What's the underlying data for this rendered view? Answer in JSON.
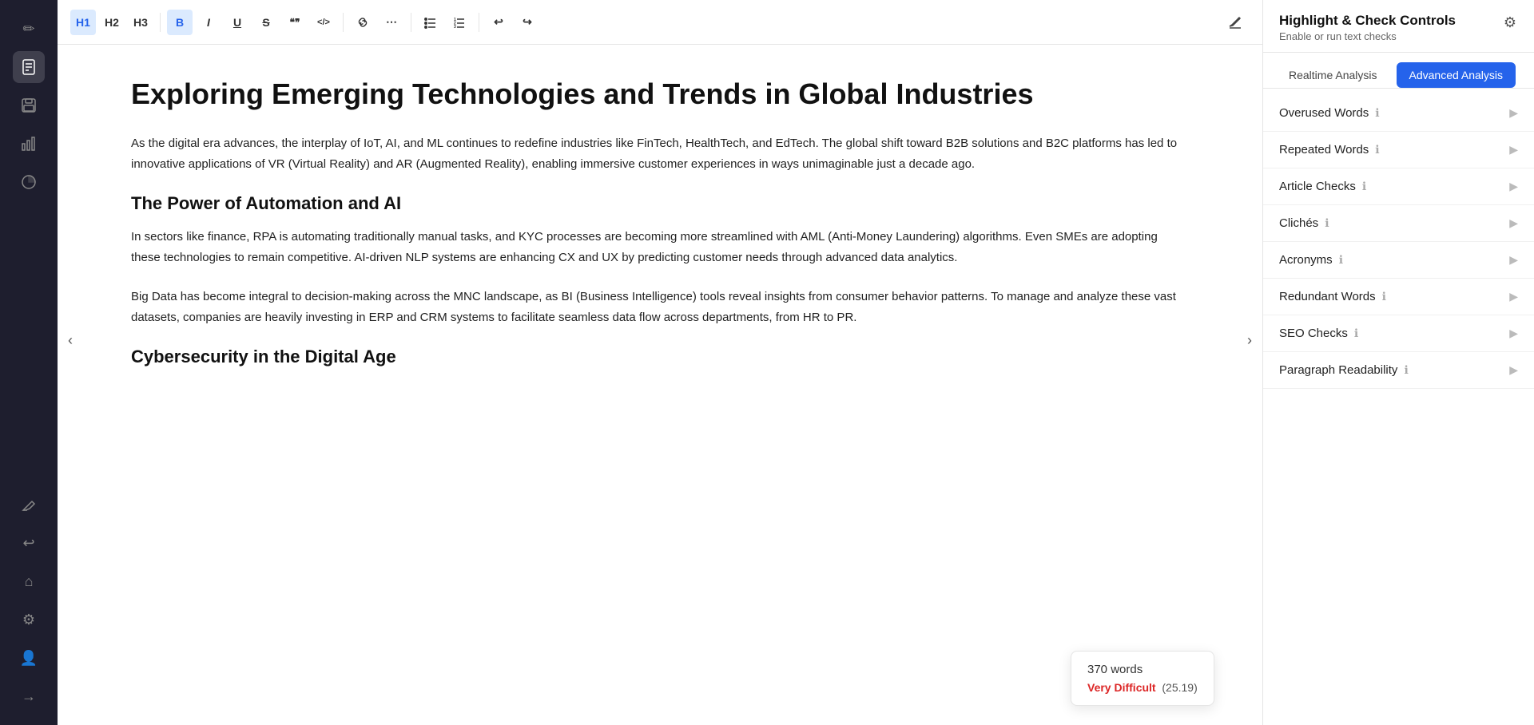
{
  "sidebar": {
    "icons": [
      {
        "name": "pen-icon",
        "symbol": "✏",
        "active": false
      },
      {
        "name": "document-icon",
        "symbol": "📄",
        "active": true
      },
      {
        "name": "save-icon",
        "symbol": "💾",
        "active": false
      },
      {
        "name": "chart-bar-icon",
        "symbol": "📊",
        "active": false
      },
      {
        "name": "chart-pie-icon",
        "symbol": "◑",
        "active": false
      },
      {
        "name": "highlight-icon",
        "symbol": "✏️",
        "active": false
      },
      {
        "name": "undo-icon",
        "symbol": "↩",
        "active": false
      },
      {
        "name": "home-icon",
        "symbol": "⌂",
        "active": false
      }
    ],
    "bottom_icons": [
      {
        "name": "settings-icon",
        "symbol": "⚙"
      },
      {
        "name": "user-icon",
        "symbol": "👤"
      },
      {
        "name": "arrow-right-icon",
        "symbol": "→"
      }
    ]
  },
  "toolbar": {
    "buttons": [
      {
        "name": "h1-button",
        "label": "H1",
        "active": true
      },
      {
        "name": "h2-button",
        "label": "H2",
        "active": false
      },
      {
        "name": "h3-button",
        "label": "H3",
        "active": false
      },
      {
        "name": "bold-button",
        "label": "B",
        "active": true
      },
      {
        "name": "italic-button",
        "label": "I",
        "active": false
      },
      {
        "name": "underline-button",
        "label": "U",
        "active": false
      },
      {
        "name": "strikethrough-button",
        "label": "S",
        "active": false
      },
      {
        "name": "quote-button",
        "label": "❝❞",
        "active": false
      },
      {
        "name": "code-button",
        "label": "</>",
        "active": false
      },
      {
        "name": "link-button",
        "label": "🔗",
        "active": false
      },
      {
        "name": "more-button",
        "label": "⋯",
        "active": false
      },
      {
        "name": "bullet-list-button",
        "label": "☰",
        "active": false
      },
      {
        "name": "numbered-list-button",
        "label": "1☰",
        "active": false
      },
      {
        "name": "undo-toolbar-button",
        "label": "↩",
        "active": false
      },
      {
        "name": "redo-toolbar-button",
        "label": "↪",
        "active": false
      }
    ],
    "edit_icon_label": "✏"
  },
  "document": {
    "title": "Exploring Emerging Technologies and Trends in Global Industries",
    "paragraphs": [
      "As the digital era advances, the interplay of IoT, AI, and ML continues to redefine industries like FinTech, HealthTech, and EdTech. The global shift toward B2B solutions and B2C platforms has led to innovative applications of VR (Virtual Reality) and AR (Augmented Reality), enabling immersive customer experiences in ways unimaginable just a decade ago.",
      "The Power of Automation and AI",
      "In sectors like finance, RPA is automating traditionally manual tasks, and KYC processes are becoming more streamlined with AML (Anti-Money Laundering) algorithms. Even SMEs are adopting these technologies to remain competitive. AI-driven NLP systems are enhancing CX and UX by predicting customer needs through advanced data analytics.",
      "Big Data has become integral to decision-making across the MNC landscape, as BI (Business Intelligence) tools reveal insights from consumer behavior patterns. To manage and analyze these vast datasets, companies are heavily investing in ERP and CRM systems to facilitate seamless data flow across departments, from HR to PR.",
      "Cybersecurity in the Digital Age"
    ]
  },
  "word_count": {
    "label": "370 words",
    "difficulty_label": "Very Difficult",
    "difficulty_score": "(25.19)"
  },
  "right_panel": {
    "title": "Highlight & Check Controls",
    "subtitle": "Enable or run text checks",
    "tabs": [
      {
        "label": "Realtime Analysis",
        "active": false
      },
      {
        "label": "Advanced Analysis",
        "active": true
      }
    ],
    "check_items": [
      {
        "label": "Overused Words",
        "info": "ℹ"
      },
      {
        "label": "Repeated Words",
        "info": "ℹ"
      },
      {
        "label": "Article Checks",
        "info": "ℹ"
      },
      {
        "label": "Clichés",
        "info": "ℹ"
      },
      {
        "label": "Acronyms",
        "info": "ℹ"
      },
      {
        "label": "Redundant Words",
        "info": "ℹ"
      },
      {
        "label": "SEO Checks",
        "info": "ℹ"
      },
      {
        "label": "Paragraph Readability",
        "info": "ℹ"
      }
    ]
  }
}
